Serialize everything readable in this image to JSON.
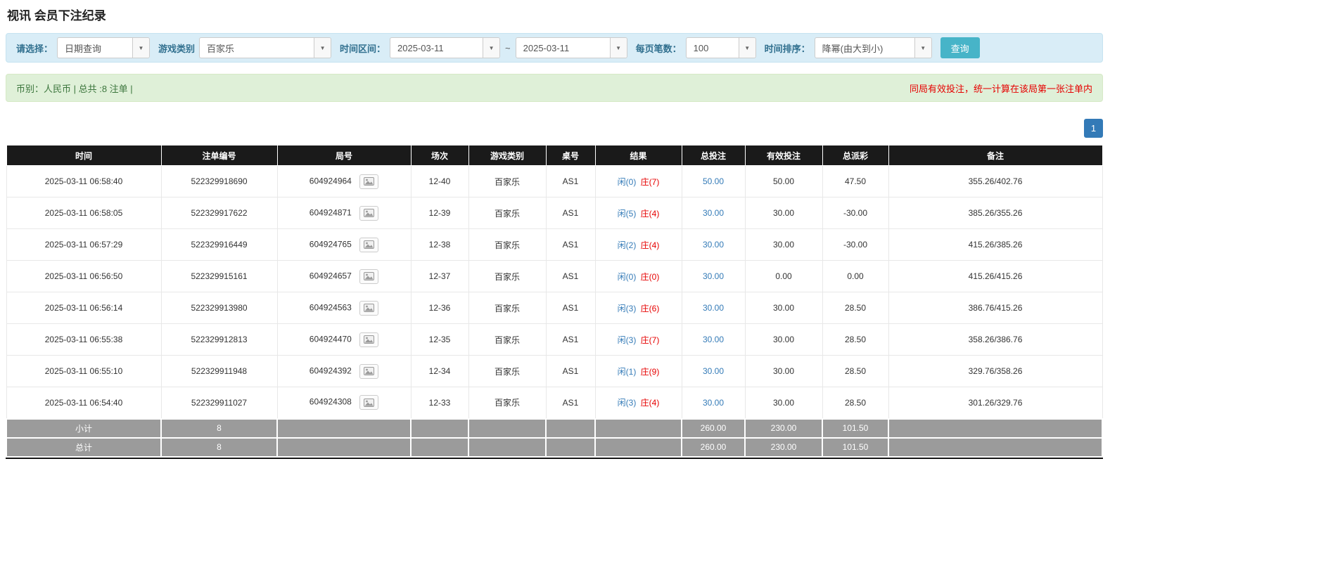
{
  "page": {
    "title": "视讯 会员下注纪录"
  },
  "colors": {
    "accent_blue": "#337ab7",
    "banker_red": "#e60000",
    "negative_red": "#e60000",
    "notice_red": "#e60000",
    "filter_bg": "#d9edf7",
    "filter_label": "#31708f",
    "summary_bg": "#dff0d8",
    "summary_text": "#3c763d",
    "search_btn": "#47b4c8",
    "header_bg": "#1a1a1a",
    "footer_bg": "#9b9b9b"
  },
  "filter": {
    "select_label": "请选择：",
    "select_value": "日期查询",
    "game_type_label": "游戏类别",
    "game_type_value": "百家乐",
    "time_range_label": "时间区间：",
    "date_from": "2025-03-11",
    "range_separator": "~",
    "date_to": "2025-03-11",
    "page_size_label": "每页笔数：",
    "page_size_value": "100",
    "sort_label": "时间排序：",
    "sort_value": "降幂(由大到小)",
    "search_button": "查询"
  },
  "summary": {
    "currency_info": "币别：人民币 | 总共 :8 注单 |",
    "notice": "同局有效投注，统一计算在该局第一张注单内"
  },
  "pagination": {
    "page": "1"
  },
  "table": {
    "headers": [
      "时间",
      "注单编号",
      "局号",
      "场次",
      "游戏类别",
      "桌号",
      "结果",
      "总投注",
      "有效投注",
      "总派彩",
      "备注"
    ],
    "rows": [
      {
        "time": "2025-03-11 06:58:40",
        "bet_id": "522329918690",
        "round_id": "604924964",
        "session": "12-40",
        "game": "百家乐",
        "table_no": "AS1",
        "player": "闲(0)",
        "banker": "庄(7)",
        "total_bet": "50.00",
        "valid_bet": "50.00",
        "payout": "47.50",
        "payout_negative": false,
        "note": "355.26/402.76"
      },
      {
        "time": "2025-03-11 06:58:05",
        "bet_id": "522329917622",
        "round_id": "604924871",
        "session": "12-39",
        "game": "百家乐",
        "table_no": "AS1",
        "player": "闲(5)",
        "banker": "庄(4)",
        "total_bet": "30.00",
        "valid_bet": "30.00",
        "payout": "-30.00",
        "payout_negative": true,
        "note": "385.26/355.26"
      },
      {
        "time": "2025-03-11 06:57:29",
        "bet_id": "522329916449",
        "round_id": "604924765",
        "session": "12-38",
        "game": "百家乐",
        "table_no": "AS1",
        "player": "闲(2)",
        "banker": "庄(4)",
        "total_bet": "30.00",
        "valid_bet": "30.00",
        "payout": "-30.00",
        "payout_negative": true,
        "note": "415.26/385.26"
      },
      {
        "time": "2025-03-11 06:56:50",
        "bet_id": "522329915161",
        "round_id": "604924657",
        "session": "12-37",
        "game": "百家乐",
        "table_no": "AS1",
        "player": "闲(0)",
        "banker": "庄(0)",
        "total_bet": "30.00",
        "valid_bet": "0.00",
        "payout": "0.00",
        "payout_negative": false,
        "note": "415.26/415.26"
      },
      {
        "time": "2025-03-11 06:56:14",
        "bet_id": "522329913980",
        "round_id": "604924563",
        "session": "12-36",
        "game": "百家乐",
        "table_no": "AS1",
        "player": "闲(3)",
        "banker": "庄(6)",
        "total_bet": "30.00",
        "valid_bet": "30.00",
        "payout": "28.50",
        "payout_negative": false,
        "note": "386.76/415.26"
      },
      {
        "time": "2025-03-11 06:55:38",
        "bet_id": "522329912813",
        "round_id": "604924470",
        "session": "12-35",
        "game": "百家乐",
        "table_no": "AS1",
        "player": "闲(3)",
        "banker": "庄(7)",
        "total_bet": "30.00",
        "valid_bet": "30.00",
        "payout": "28.50",
        "payout_negative": false,
        "note": "358.26/386.76"
      },
      {
        "time": "2025-03-11 06:55:10",
        "bet_id": "522329911948",
        "round_id": "604924392",
        "session": "12-34",
        "game": "百家乐",
        "table_no": "AS1",
        "player": "闲(1)",
        "banker": "庄(9)",
        "total_bet": "30.00",
        "valid_bet": "30.00",
        "payout": "28.50",
        "payout_negative": false,
        "note": "329.76/358.26"
      },
      {
        "time": "2025-03-11 06:54:40",
        "bet_id": "522329911027",
        "round_id": "604924308",
        "session": "12-33",
        "game": "百家乐",
        "table_no": "AS1",
        "player": "闲(3)",
        "banker": "庄(4)",
        "total_bet": "30.00",
        "valid_bet": "30.00",
        "payout": "28.50",
        "payout_negative": false,
        "note": "301.26/329.76"
      }
    ],
    "footer_rows": [
      {
        "label": "小计",
        "count": "8",
        "total_bet": "260.00",
        "valid_bet": "230.00",
        "payout": "101.50"
      },
      {
        "label": "总计",
        "count": "8",
        "total_bet": "260.00",
        "valid_bet": "230.00",
        "payout": "101.50"
      }
    ]
  }
}
